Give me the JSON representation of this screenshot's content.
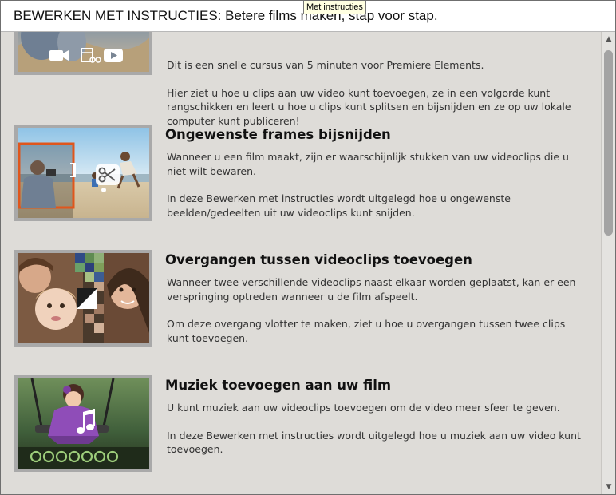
{
  "header": {
    "title": "BEWERKEN MET INSTRUCTIES: Betere films maken, stap voor stap."
  },
  "tooltip": {
    "text": "Met instructies"
  },
  "items": [
    {
      "title": "",
      "paragraphs": [
        "Dit is een snelle cursus van 5 minuten voor Premiere Elements.",
        "Hier ziet u hoe u clips aan uw video kunt toevoegen, ze in een volgorde kunt rangschikken en leert u hoe u clips kunt splitsen en bijsnijden en ze op uw lokale computer kunt publiceren!"
      ],
      "icons": [
        "video-camera-icon",
        "film-scissors-icon",
        "play-icon"
      ]
    },
    {
      "title": "Ongewenste frames bijsnijden",
      "paragraphs": [
        "Wanneer u een film maakt, zijn er waarschijnlijk stukken van uw videoclips die u niet wilt bewaren.",
        "In deze Bewerken met instructies wordt uitgelegd hoe u ongewenste beelden/gedeelten uit uw videoclips kunt snijden."
      ],
      "icons": [
        "scissors-icon"
      ]
    },
    {
      "title": "Overgangen tussen videoclips toevoegen",
      "paragraphs": [
        "Wanneer twee verschillende videoclips naast elkaar worden geplaatst, kan er een verspringing optreden wanneer u de film afspeelt.",
        "Om deze overgang vlotter te maken, ziet u hoe u overgangen tussen twee clips kunt toevoegen."
      ],
      "icons": [
        "transition-icon"
      ]
    },
    {
      "title": "Muziek toevoegen aan uw film",
      "paragraphs": [
        "U kunt muziek aan uw videoclips toevoegen om de video meer sfeer te geven.",
        "In deze Bewerken met instructies wordt uitgelegd hoe u muziek aan uw video kunt toevoegen."
      ],
      "icons": [
        "music-note-icon"
      ]
    }
  ],
  "colors": {
    "background": "#dedcd8",
    "thumbnail_border": "#a9a9a9",
    "trim_frame": "#e0561c",
    "header_background": "#ffffff"
  }
}
